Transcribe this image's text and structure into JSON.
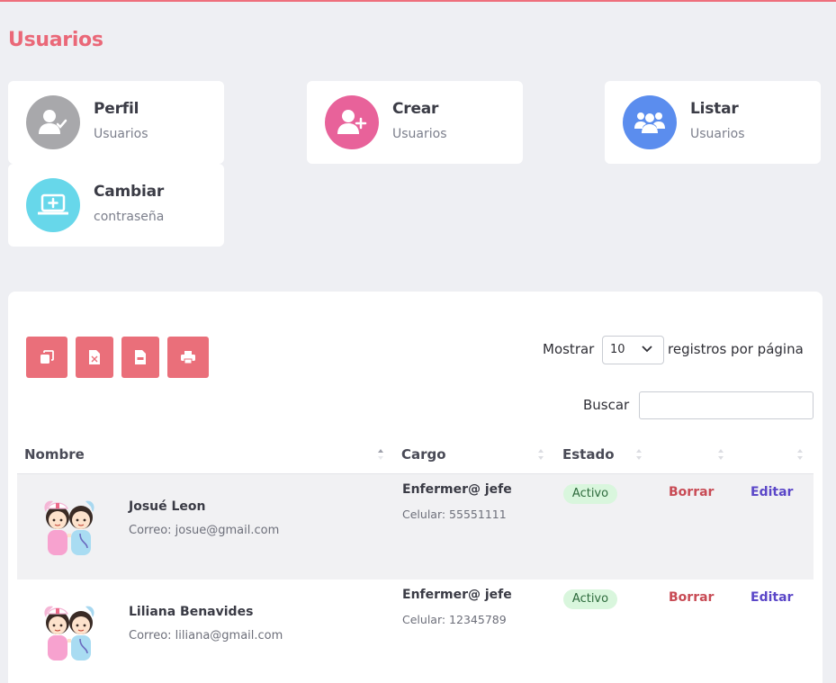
{
  "page": {
    "title": "Usuarios"
  },
  "cards": [
    {
      "title": "Perfil",
      "subtitle": "Usuarios",
      "icon": "user-check-icon",
      "color": "#a8a8ab"
    },
    {
      "title": "Crear",
      "subtitle": "Usuarios",
      "icon": "user-plus-icon",
      "color": "#e8629a"
    },
    {
      "title": "Listar",
      "subtitle": "Usuarios",
      "icon": "users-group-icon",
      "color": "#5b8dee"
    },
    {
      "title": "Cambiar",
      "subtitle": "contraseña",
      "icon": "laptop-plus-icon",
      "color": "#67d7ea"
    }
  ],
  "toolbar": {
    "buttons": [
      {
        "icon": "copy-icon"
      },
      {
        "icon": "excel-icon"
      },
      {
        "icon": "pdf-icon"
      },
      {
        "icon": "print-icon"
      }
    ],
    "accent": "#ea6f7a"
  },
  "length": {
    "label_before": "Mostrar",
    "value": "10",
    "label_after": "registros por página"
  },
  "search": {
    "label": "Buscar",
    "value": ""
  },
  "table": {
    "columns": [
      "Nombre",
      "Cargo",
      "Estado",
      "",
      ""
    ],
    "rows": [
      {
        "name": "Josué Leon",
        "email": "Correo: josue@gmail.com",
        "role": "Enfermer@ jefe",
        "phone": "Celular: 55551111",
        "status": "Activo",
        "delete": "Borrar",
        "edit": "Editar"
      },
      {
        "name": "Liliana Benavides",
        "email": "Correo: liliana@gmail.com",
        "role": "Enfermer@ jefe",
        "phone": "Celular: 12345789",
        "status": "Activo",
        "delete": "Borrar",
        "edit": "Editar"
      }
    ]
  }
}
